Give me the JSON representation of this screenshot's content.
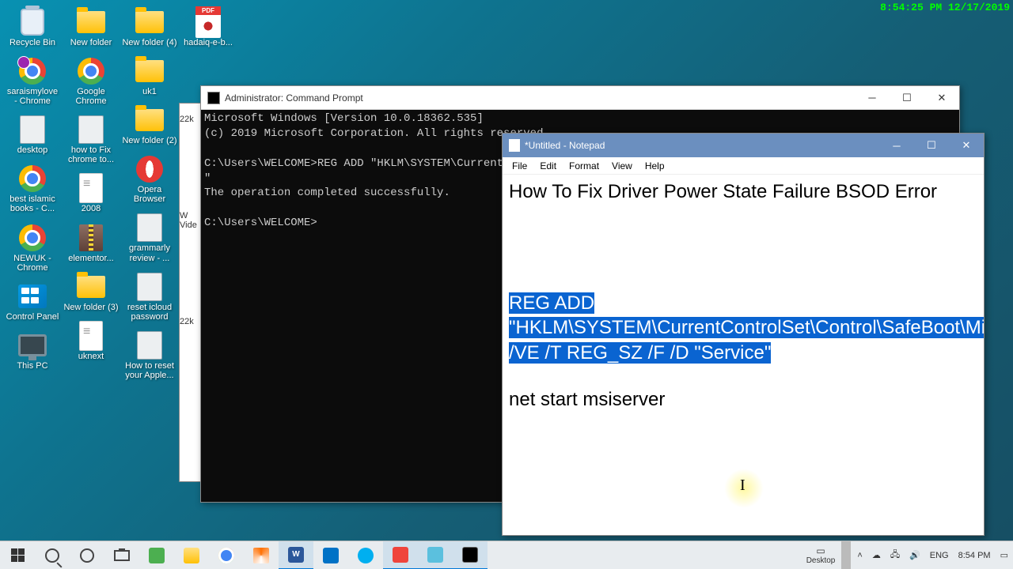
{
  "overlay_clock": "8:54:25 PM 12/17/2019",
  "desktop_columns": [
    [
      {
        "icon": "bin",
        "label": "Recycle Bin"
      },
      {
        "icon": "chrome-badge",
        "label": "saraismylove - Chrome"
      },
      {
        "icon": "generic",
        "label": "desktop"
      },
      {
        "icon": "chrome",
        "label": "best islamic books - C..."
      },
      {
        "icon": "chrome",
        "label": "NEWUK - Chrome"
      },
      {
        "icon": "ctrl",
        "label": "Control Panel"
      },
      {
        "icon": "thispc",
        "label": "This PC"
      }
    ],
    [
      {
        "icon": "folder",
        "label": "New folder"
      },
      {
        "icon": "chrome",
        "label": "Google Chrome"
      },
      {
        "icon": "generic",
        "label": "how to Fix chrome to..."
      },
      {
        "icon": "rtf",
        "label": "2008"
      },
      {
        "icon": "winrar",
        "label": "elementor..."
      },
      {
        "icon": "folder",
        "label": "New folder (3)"
      },
      {
        "icon": "rtf",
        "label": "uknext"
      }
    ],
    [
      {
        "icon": "folder",
        "label": "New folder (4)"
      },
      {
        "icon": "folder",
        "label": "uk1"
      },
      {
        "icon": "folder",
        "label": "New folder (2)"
      },
      {
        "icon": "opera",
        "label": "Opera Browser"
      },
      {
        "icon": "generic",
        "label": "grammarly review - ..."
      },
      {
        "icon": "generic",
        "label": "reset icloud password"
      },
      {
        "icon": "generic",
        "label": "How to reset your Apple..."
      }
    ],
    [
      {
        "icon": "pdf",
        "label": "hadaiq-e-b..."
      }
    ]
  ],
  "hidden_window": {
    "label_lines": [
      "22k",
      "W",
      "Vide",
      "22k"
    ]
  },
  "cmd": {
    "title": "Administrator: Command Prompt",
    "lines": "Microsoft Windows [Version 10.0.18362.535]\n(c) 2019 Microsoft Corporation. All rights reserved.\n\nC:\\Users\\WELCOME>REG ADD \"HKLM\\SYSTEM\\CurrentCon\n\"\nThe operation completed successfully.\n\nC:\\Users\\WELCOME>"
  },
  "notepad": {
    "title": "*Untitled - Notepad",
    "menu": [
      "File",
      "Edit",
      "Format",
      "View",
      "Help"
    ],
    "heading": "How To Fix Driver Power State Failure BSOD Error",
    "selected": "REG ADD \"HKLM\\SYSTEM\\CurrentControlSet\\Control\\SafeBoot\\Minimal\\MSIServer\" /VE /T REG_SZ /F /D \"Service\"",
    "line3": "net start msiserver"
  },
  "taskbar": {
    "tray_desktop_label": "Desktop",
    "tray_lang": "ENG",
    "tray_time": "8:54 PM"
  }
}
